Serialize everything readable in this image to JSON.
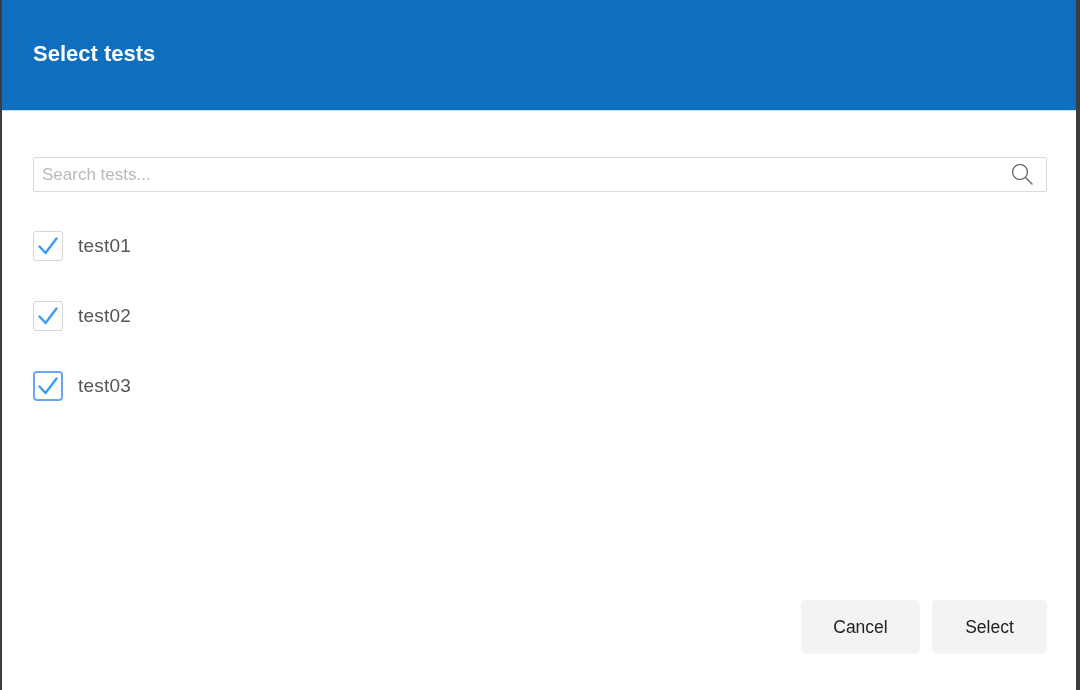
{
  "dialog": {
    "title": "Select tests",
    "search": {
      "placeholder": "Search tests..."
    },
    "tests": [
      {
        "label": "test01",
        "checked": true,
        "focused": false
      },
      {
        "label": "test02",
        "checked": true,
        "focused": false
      },
      {
        "label": "test03",
        "checked": true,
        "focused": true
      }
    ],
    "buttons": [
      "Cancel",
      "Select"
    ]
  }
}
